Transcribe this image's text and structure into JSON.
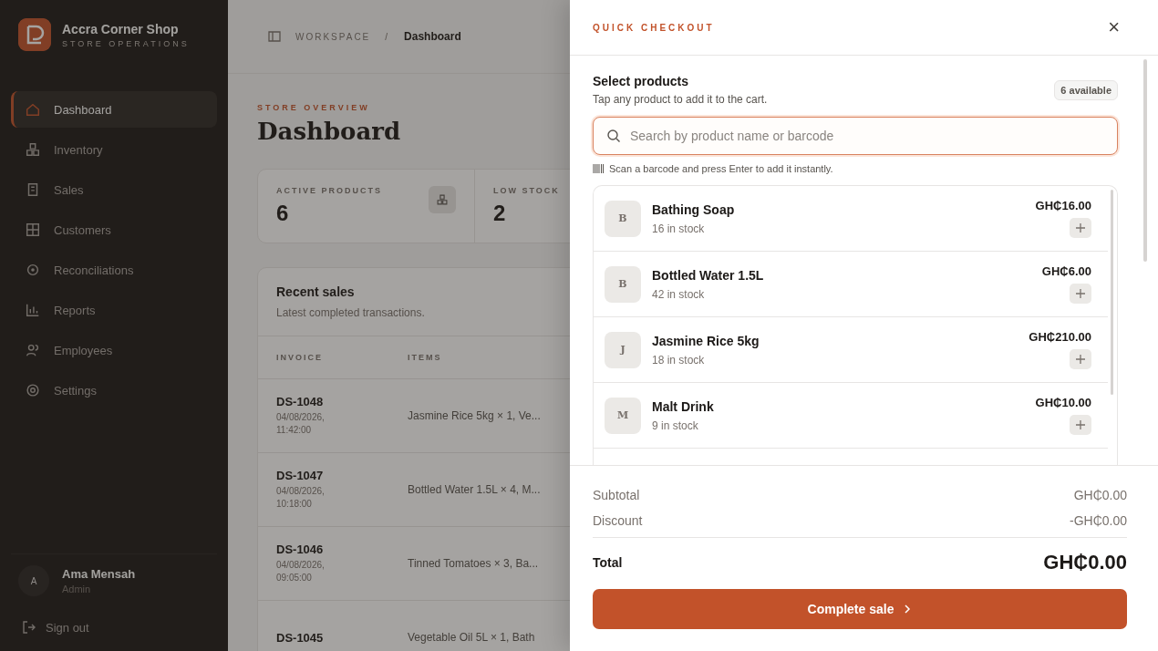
{
  "sidebar": {
    "brand": {
      "name": "Accra Corner Shop",
      "subtitle": "STORE OPERATIONS"
    },
    "items": [
      {
        "label": "Dashboard",
        "selected": true
      },
      {
        "label": "Inventory",
        "selected": false
      },
      {
        "label": "Sales",
        "selected": false
      },
      {
        "label": "Customers",
        "selected": false
      },
      {
        "label": "Reconciliations",
        "selected": false
      },
      {
        "label": "Reports",
        "selected": false
      },
      {
        "label": "Employees",
        "selected": false
      },
      {
        "label": "Settings",
        "selected": false
      }
    ],
    "user": {
      "initial": "A",
      "name": "Ama Mensah",
      "role": "Admin"
    },
    "sign_out": "Sign out"
  },
  "header": {
    "breadcrumb": [
      "WORKSPACE",
      "Dashboard"
    ],
    "separator": "/"
  },
  "page": {
    "eyebrow": "STORE OVERVIEW",
    "title": "Dashboard",
    "stats": [
      {
        "label": "ACTIVE PRODUCTS",
        "value": "6"
      },
      {
        "label": "LOW STOCK",
        "value": "2"
      }
    ],
    "recent_sales": {
      "title": "Recent sales",
      "subtitle": "Latest completed transactions.",
      "columns": [
        "INVOICE",
        "ITEMS"
      ],
      "rows": [
        {
          "invoice": "DS-1048",
          "date": "04/08/2026,",
          "time": "11:42:00",
          "items": "Jasmine Rice 5kg × 1, Ve..."
        },
        {
          "invoice": "DS-1047",
          "date": "04/08/2026,",
          "time": "10:18:00",
          "items": "Bottled Water 1.5L × 4, M..."
        },
        {
          "invoice": "DS-1046",
          "date": "04/08/2026,",
          "time": "09:05:00",
          "items": "Tinned Tomatoes × 3, Ba..."
        },
        {
          "invoice": "DS-1045",
          "items": "Vegetable Oil 5L × 1, Bath"
        }
      ]
    }
  },
  "drawer": {
    "title": "QUICK CHECKOUT",
    "close": "×",
    "section_title": "Select products",
    "section_subtitle": "Tap any product to add it to the cart.",
    "badge": "6 available",
    "search": {
      "placeholder": "Search by product name or barcode"
    },
    "hint": "Scan a barcode and press Enter to add it instantly.",
    "products": [
      {
        "initial": "B",
        "name": "Bathing Soap",
        "stock": "16 in stock",
        "price": "GH₵16.00"
      },
      {
        "initial": "B",
        "name": "Bottled Water 1.5L",
        "stock": "42 in stock",
        "price": "GH₵6.00"
      },
      {
        "initial": "J",
        "name": "Jasmine Rice 5kg",
        "stock": "18 in stock",
        "price": "GH₵210.00"
      },
      {
        "initial": "M",
        "name": "Malt Drink",
        "stock": "9 in stock",
        "price": "GH₵10.00"
      }
    ],
    "summary": [
      {
        "label": "Subtotal",
        "value": "GH₵0.00"
      },
      {
        "label": "Discount",
        "value": "-GH₵0.00"
      }
    ],
    "total": {
      "label": "Total",
      "value": "GH₵0.00"
    },
    "submit": "Complete sale"
  }
}
